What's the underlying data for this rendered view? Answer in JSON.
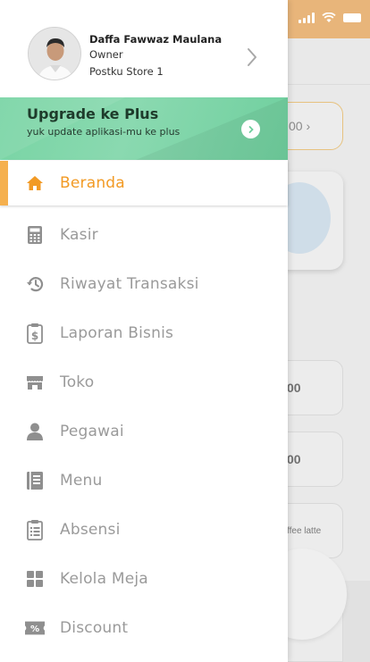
{
  "background": {
    "pill_text": "00 ›",
    "card_values": [
      "00",
      "00"
    ],
    "card_item_text": "ffee latte"
  },
  "profile": {
    "name": "Daffa Fawwaz Maulana",
    "role": "Owner",
    "store": "Postku Store 1"
  },
  "upgrade": {
    "title": "Upgrade ke Plus",
    "subtitle": "yuk update aplikasi-mu ke plus"
  },
  "menu": {
    "items": [
      {
        "label": "Beranda",
        "icon": "home-icon",
        "active": true
      },
      {
        "label": "Kasir",
        "icon": "calculator-icon"
      },
      {
        "label": "Riwayat Transaksi",
        "icon": "history-icon"
      },
      {
        "label": "Laporan Bisnis",
        "icon": "report-icon"
      },
      {
        "label": "Toko",
        "icon": "store-icon"
      },
      {
        "label": "Pegawai",
        "icon": "user-icon"
      },
      {
        "label": "Menu",
        "icon": "menu-book-icon"
      },
      {
        "label": "Absensi",
        "icon": "clipboard-icon"
      },
      {
        "label": "Kelola Meja",
        "icon": "grid-icon"
      },
      {
        "label": "Discount",
        "icon": "discount-icon"
      }
    ]
  },
  "colors": {
    "accent": "#f29a24",
    "active_bar": "#f5b04e",
    "upgrade_bg": "#78d4a4",
    "status_bar": "#e8b57a",
    "icon_gray": "#8f8f8f"
  }
}
